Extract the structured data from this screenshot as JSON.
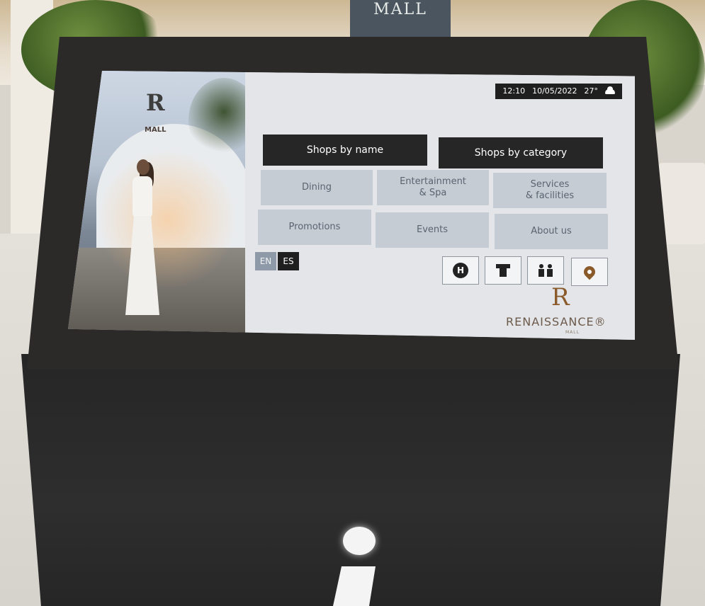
{
  "environment": {
    "mall_sign_text": "MALL"
  },
  "hero": {
    "logo_letter": "R",
    "logo_text": "MALL"
  },
  "status_bar": {
    "time": "12:10",
    "date": "10/05/2022",
    "temperature": "27°",
    "weather_icon": "cloud-icon"
  },
  "primary_nav": {
    "shops_by_name": "Shops by name",
    "shops_by_category": "Shops by category"
  },
  "categories": {
    "dining": "Dining",
    "entertainment_spa": "Entertainment\n& Spa",
    "services_facilities": "Services\n& facilities",
    "promotions": "Promotions",
    "events": "Events",
    "about_us": "About us"
  },
  "language": {
    "options": [
      "EN",
      "ES"
    ],
    "selected": "EN"
  },
  "quick_icons": [
    {
      "name": "hotel-icon",
      "label": "H"
    },
    {
      "name": "atm-icon"
    },
    {
      "name": "restroom-icon"
    },
    {
      "name": "location-pin-icon"
    }
  ],
  "brand": {
    "letter": "R",
    "name": "RENAISSANCE®",
    "sub": "MALL"
  },
  "colors": {
    "dark_button": "#262626",
    "light_button": "#c5ccd4",
    "brand_accent": "#8a5a2b"
  }
}
